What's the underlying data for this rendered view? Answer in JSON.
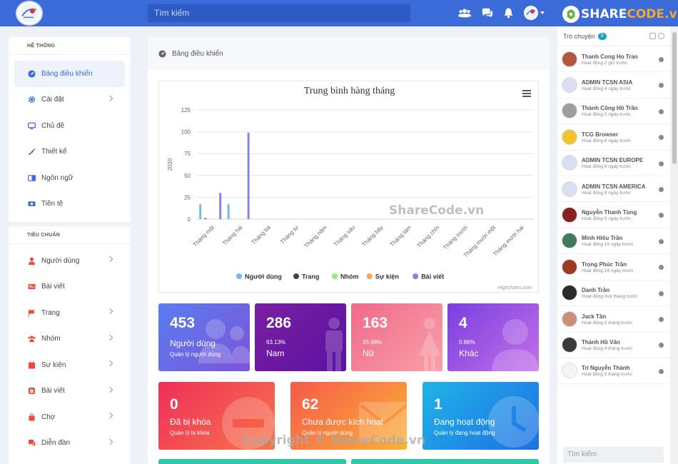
{
  "topbar": {
    "search_placeholder": "Tìm kiếm",
    "brand_prefix": "SHARE",
    "brand_suffix": "CODE.vn"
  },
  "sidebar": {
    "section1": "HỆ THỐNG",
    "section2": "TIÊU CHUẨN",
    "system_items": [
      {
        "label": "Bảng điều khiển",
        "icon": "dashboard-icon",
        "active": true,
        "arrow": false
      },
      {
        "label": "Cài đặt",
        "icon": "gear-icon",
        "arrow": true
      },
      {
        "label": "Chủ đề",
        "icon": "monitor-icon",
        "arrow": false
      },
      {
        "label": "Thiết kế",
        "icon": "brush-icon",
        "arrow": false
      },
      {
        "label": "Ngôn ngữ",
        "icon": "language-icon",
        "arrow": false
      },
      {
        "label": "Tiền tệ",
        "icon": "money-icon",
        "arrow": false
      }
    ],
    "standard_items": [
      {
        "label": "Người dùng",
        "icon": "user-icon",
        "arrow": true
      },
      {
        "label": "Bài viết",
        "icon": "newspaper-icon",
        "arrow": false
      },
      {
        "label": "Trang",
        "icon": "flag-icon",
        "arrow": true
      },
      {
        "label": "Nhóm",
        "icon": "group-icon",
        "arrow": true
      },
      {
        "label": "Sự kiện",
        "icon": "calendar-icon",
        "arrow": true
      },
      {
        "label": "Bài viết",
        "icon": "blog-icon",
        "arrow": true
      },
      {
        "label": "Chợ",
        "icon": "bag-icon",
        "arrow": true
      },
      {
        "label": "Diễn đàn",
        "icon": "comments-icon",
        "arrow": true
      }
    ]
  },
  "main": {
    "title": "Bảng điều khiển"
  },
  "chart_data": {
    "type": "bar",
    "title": "Trung bình hàng tháng",
    "ylabel": "2020",
    "xlabel": "",
    "ylim": [
      0,
      125
    ],
    "yticks": [
      0,
      25,
      50,
      75,
      100,
      125
    ],
    "categories": [
      "Tháng một",
      "Tháng hai",
      "Tháng ba",
      "Tháng tư",
      "Tháng năm",
      "Tháng sáu",
      "Tháng bảy",
      "Tháng tám",
      "Tháng chín",
      "Tháng mười",
      "Tháng mười một",
      "Tháng mười hai"
    ],
    "series": [
      {
        "name": "Người dùng",
        "color": "#7cb5ec",
        "values": [
          17,
          17,
          0,
          0,
          0,
          0,
          0,
          0,
          0,
          0,
          0,
          0
        ]
      },
      {
        "name": "Trang",
        "color": "#434348",
        "values": [
          1,
          0,
          0,
          0,
          0,
          0,
          0,
          0,
          0,
          0,
          0,
          0
        ]
      },
      {
        "name": "Nhóm",
        "color": "#90ed7d",
        "values": [
          0,
          0,
          0,
          0,
          0,
          0,
          0,
          0,
          0,
          0,
          0,
          0
        ]
      },
      {
        "name": "Sự kiện",
        "color": "#f7a35c",
        "values": [
          0,
          0,
          0,
          0,
          0,
          0,
          0,
          0,
          0,
          0,
          0,
          0
        ]
      },
      {
        "name": "Bài viết",
        "color": "#8085e9",
        "values": [
          30,
          99,
          0,
          0,
          0,
          0,
          0,
          0,
          0,
          0,
          0,
          0
        ]
      }
    ],
    "legend_position": "bottom",
    "credit": "Highcharts.com"
  },
  "stats": [
    {
      "num": "453",
      "label": "Người dùng",
      "sub": "Quản lý người dùng"
    },
    {
      "num": "286",
      "sub": "63.13%",
      "label": "Nam"
    },
    {
      "num": "163",
      "sub": "35.98%",
      "label": "Nữ"
    },
    {
      "num": "4",
      "sub": "0.88%",
      "label": "Khác"
    },
    {
      "num": "0",
      "label": "Đã bị khóa",
      "sub": "Quản lý bị khóa"
    },
    {
      "num": "62",
      "label": "Chưa được kích hoạt",
      "sub": "Quản lý người dùng"
    },
    {
      "num": "1",
      "label": "Đang hoạt động",
      "sub": "Quản lý đang hoạt động"
    }
  ],
  "chat": {
    "title": "Trò chuyện",
    "count": "0",
    "search_placeholder": "Tìm kiếm",
    "contacts": [
      {
        "name": "Thanh Cong Ho Tran",
        "time": "Hoạt động 2 giờ trước",
        "color": "#b5563f"
      },
      {
        "name": "ADMIN TCSN ASIA",
        "time": "Hoạt động 4 ngày trước",
        "color": "#d9dff0"
      },
      {
        "name": "Thành Công Hồ Trần",
        "time": "Hoạt động 5 ngày trước",
        "color": "#9aa09a"
      },
      {
        "name": "TCG Browser",
        "time": "Hoạt động 6 ngày trước",
        "color": "#f2c230"
      },
      {
        "name": "ADMIN TCSN EUROPE",
        "time": "Hoạt động 6 ngày trước",
        "color": "#d9dff0"
      },
      {
        "name": "ADMIN TCSN AMERICA",
        "time": "Hoạt động 9 ngày trước",
        "color": "#d9dff0"
      },
      {
        "name": "Nguyễn Thanh Tùng",
        "time": "Hoạt động 9 ngày trước",
        "color": "#8a1f1f"
      },
      {
        "name": "Minh Hiếu Trần",
        "time": "Hoạt động 19 ngày trước",
        "color": "#3e7a5c"
      },
      {
        "name": "Trọng Phúc Trần",
        "time": "Hoạt động 24 ngày trước",
        "color": "#9c3a22"
      },
      {
        "name": "Danh Trần",
        "time": "Hoạt động một tháng trước",
        "color": "#2b2b2b"
      },
      {
        "name": "Jack Tân",
        "time": "Hoạt động 3 tháng trước",
        "color": "#c98f7a"
      },
      {
        "name": "Thành Hồ Văn",
        "time": "Hoạt động 4 tháng trước",
        "color": "#3a3a3a"
      },
      {
        "name": "Trí Nguyễn Thành",
        "time": "Hoạt động 5 tháng trước",
        "color": "#f4f4f4"
      }
    ]
  },
  "watermarks": {
    "center": "ShareCode.vn",
    "bottom": "Copyright © ShareCode.vn"
  }
}
